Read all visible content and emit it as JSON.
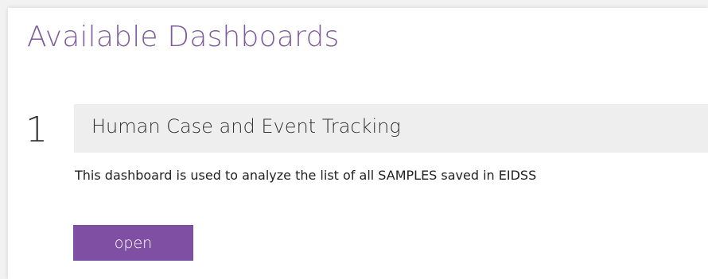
{
  "page": {
    "title": "Available Dashboards"
  },
  "dashboards": [
    {
      "number": "1",
      "title": "Human Case and Event Tracking",
      "description": "This dashboard is used to analyze the list of all SAMPLES saved in EIDSS",
      "open_label": "open"
    }
  ],
  "colors": {
    "accent": "#7e4fa3",
    "title": "#7e5c9e",
    "header_bg": "#eeeeee"
  }
}
